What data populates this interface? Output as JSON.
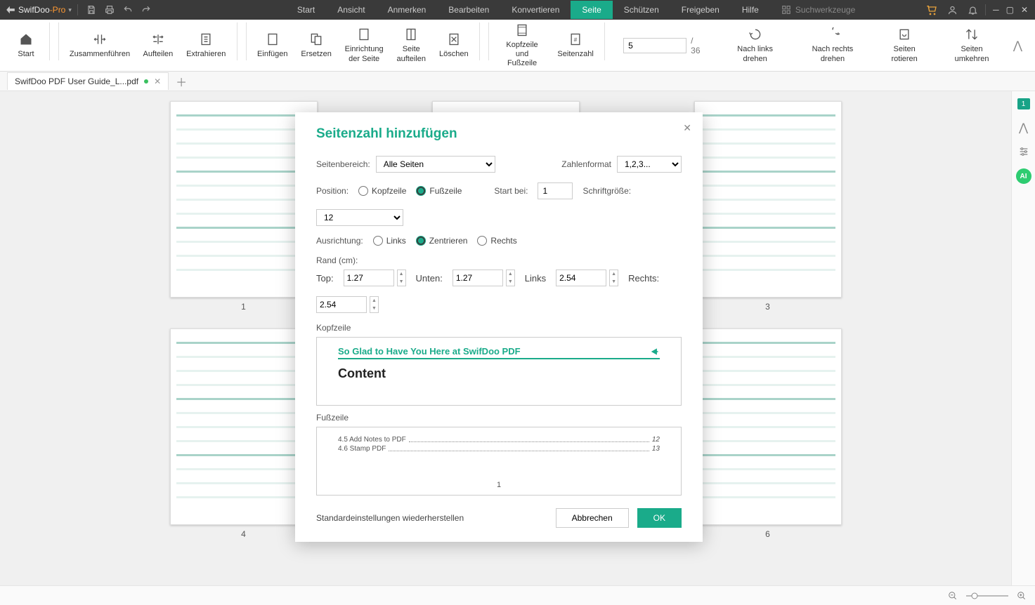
{
  "app": {
    "name": "SwifDoo",
    "suffix": "-Pro"
  },
  "menu": [
    "Start",
    "Ansicht",
    "Anmerken",
    "Bearbeiten",
    "Konvertieren",
    "Seite",
    "Schützen",
    "Freigeben",
    "Hilfe"
  ],
  "menu_active_index": 5,
  "search_placeholder": "Suchwerkzeuge",
  "ribbon": {
    "buttons": [
      {
        "label": "Start"
      },
      {
        "label": "Zusammenführen"
      },
      {
        "label": "Aufteilen"
      },
      {
        "label": "Extrahieren"
      },
      {
        "label": "Einfügen"
      },
      {
        "label": "Ersetzen"
      },
      {
        "label": "Einrichtung der Seite"
      },
      {
        "label": "Seite aufteilen"
      },
      {
        "label": "Löschen"
      },
      {
        "label": "Kopfzeile und Fußzeile"
      },
      {
        "label": "Seitenzahl"
      }
    ],
    "page_input": "5",
    "total_pages": "/ 36",
    "rotate_left": "Nach links drehen",
    "rotate_right": "Nach rechts drehen",
    "rotate_pages": "Seiten rotieren",
    "reverse": "Seiten umkehren"
  },
  "doc_tab": {
    "title": "SwifDoo PDF User Guide_L...pdf"
  },
  "right_strip": {
    "badge": "1"
  },
  "thumbs": {
    "labels": [
      "1",
      "",
      "3",
      "4",
      "",
      "6"
    ]
  },
  "modal": {
    "title": "Seitenzahl hinzufügen",
    "page_range_label": "Seitenbereich:",
    "page_range_value": "Alle Seiten",
    "number_format_label": "Zahlenformat",
    "number_format_value": "1,2,3...",
    "position_label": "Position:",
    "position_options": {
      "header": "Kopfzeile",
      "footer": "Fußzeile"
    },
    "position_selected": "footer",
    "start_at_label": "Start bei:",
    "start_at_value": "1",
    "font_size_label": "Schriftgröße:",
    "font_size_value": "12",
    "align_label": "Ausrichtung:",
    "align_options": {
      "left": "Links",
      "center": "Zentrieren",
      "right": "Rechts"
    },
    "align_selected": "center",
    "margin_label": "Rand (cm):",
    "margins": {
      "top_label": "Top:",
      "top": "1.27",
      "bottom_label": "Unten:",
      "bottom": "1.27",
      "left_label": "Links",
      "left": "2.54",
      "right_label": "Rechts:",
      "right": "2.54"
    },
    "header_section": "Kopfzeile",
    "header_preview_title": "So Glad to Have You Here at SwifDoo PDF",
    "header_preview_content": "Content",
    "footer_section": "Fußzeile",
    "footer_toc": [
      {
        "text": "4.5 Add Notes to PDF",
        "page": "12"
      },
      {
        "text": "4.6 Stamp PDF",
        "page": "13"
      }
    ],
    "footer_page_num": "1",
    "reset": "Standardeinstellungen wiederherstellen",
    "cancel": "Abbrechen",
    "ok": "OK"
  }
}
